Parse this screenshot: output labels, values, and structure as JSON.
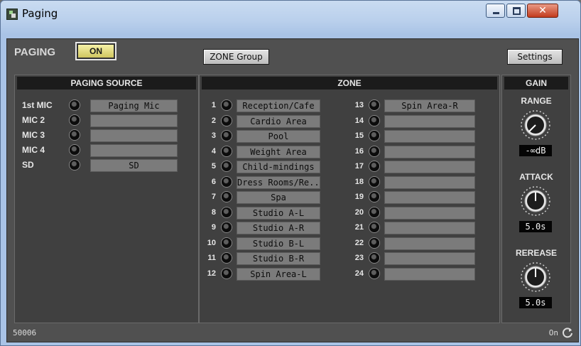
{
  "window": {
    "title": "Paging",
    "close_glyph": "✕"
  },
  "header": {
    "paging_label": "PAGING",
    "on_label": "ON",
    "zone_group_label": "ZONE Group",
    "settings_label": "Settings"
  },
  "paging_source": {
    "title": "PAGING SOURCE",
    "rows": [
      {
        "label": "1st MIC",
        "name": "Paging Mic"
      },
      {
        "label": "MIC 2",
        "name": ""
      },
      {
        "label": "MIC 3",
        "name": ""
      },
      {
        "label": "MIC 4",
        "name": ""
      },
      {
        "label": "SD",
        "name": "SD"
      }
    ]
  },
  "zone": {
    "title": "ZONE",
    "left": [
      {
        "num": "1",
        "name": "Reception/Cafe"
      },
      {
        "num": "2",
        "name": "Cardio Area"
      },
      {
        "num": "3",
        "name": "Pool"
      },
      {
        "num": "4",
        "name": "Weight Area"
      },
      {
        "num": "5",
        "name": "Child-mindings"
      },
      {
        "num": "6",
        "name": "Dress Rooms/Re..."
      },
      {
        "num": "7",
        "name": "Spa"
      },
      {
        "num": "8",
        "name": "Studio A-L"
      },
      {
        "num": "9",
        "name": "Studio A-R"
      },
      {
        "num": "10",
        "name": "Studio B-L"
      },
      {
        "num": "11",
        "name": "Studio B-R"
      },
      {
        "num": "12",
        "name": "Spin Area-L"
      }
    ],
    "right": [
      {
        "num": "13",
        "name": "Spin Area-R"
      },
      {
        "num": "14",
        "name": ""
      },
      {
        "num": "15",
        "name": ""
      },
      {
        "num": "16",
        "name": ""
      },
      {
        "num": "17",
        "name": ""
      },
      {
        "num": "18",
        "name": ""
      },
      {
        "num": "19",
        "name": ""
      },
      {
        "num": "20",
        "name": ""
      },
      {
        "num": "21",
        "name": ""
      },
      {
        "num": "22",
        "name": ""
      },
      {
        "num": "23",
        "name": ""
      },
      {
        "num": "24",
        "name": ""
      }
    ]
  },
  "gain": {
    "title": "GAIN",
    "range_label": "RANGE",
    "range_value": "-∞dB",
    "attack_label": "ATTACK",
    "attack_value": "5.0s",
    "release_label": "REREASE",
    "release_value": "5.0s"
  },
  "status": {
    "id": "50006",
    "state": "On",
    "icon": "refresh-icon"
  },
  "colors": {
    "on_button": "#e8e28a",
    "panel_bg": "#404040",
    "window_bg": "#505050"
  }
}
